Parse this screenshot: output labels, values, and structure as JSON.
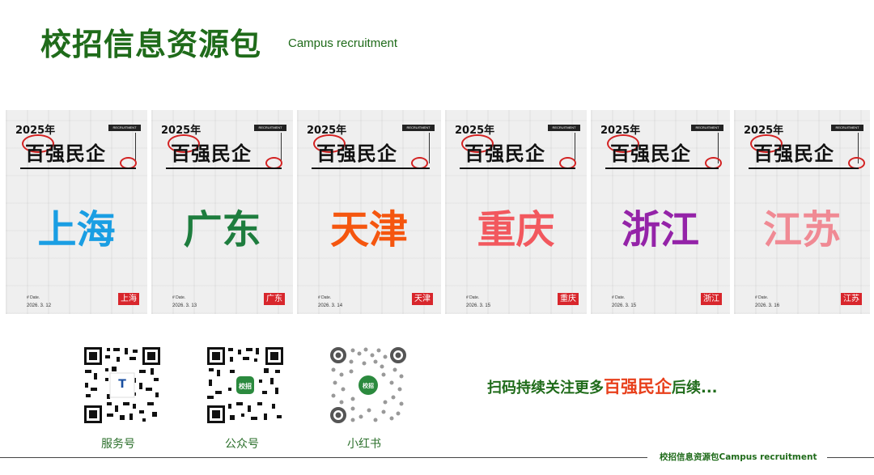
{
  "header": {
    "title": "校招信息资源包",
    "subtitle": "Campus recruitment"
  },
  "cards": [
    {
      "year": "2025年",
      "badge": "RECRUITMENT",
      "headline": "百强民企",
      "city": "上海",
      "city_color": "#1a9ee3",
      "date_label": "# Date.",
      "date": "2026. 3. 12",
      "tag": "上海"
    },
    {
      "year": "2025年",
      "badge": "RECRUITMENT",
      "headline": "百强民企",
      "city": "广东",
      "city_color": "#1e7d3e",
      "date_label": "# Date.",
      "date": "2026. 3. 13",
      "tag": "广东"
    },
    {
      "year": "2025年",
      "badge": "RECRUITMENT",
      "headline": "百强民企",
      "city": "天津",
      "city_color": "#f5560f",
      "date_label": "# Date.",
      "date": "2026. 3. 14",
      "tag": "天津"
    },
    {
      "year": "2025年",
      "badge": "RECRUITMENT",
      "headline": "百强民企",
      "city": "重庆",
      "city_color": "#f2585e",
      "date_label": "# Date.",
      "date": "2026. 3. 15",
      "tag": "重庆"
    },
    {
      "year": "2025年",
      "badge": "RECRUITMENT",
      "headline": "百强民企",
      "city": "浙江",
      "city_color": "#9423a8",
      "date_label": "# Date.",
      "date": "2026. 3. 15",
      "tag": "浙江"
    },
    {
      "year": "2025年",
      "badge": "RECRUITMENT",
      "headline": "百强民企",
      "city": "江苏",
      "city_color": "#f08a94",
      "date_label": "# Date.",
      "date": "2026. 3. 16",
      "tag": "江苏"
    }
  ],
  "qr_codes": [
    {
      "label": "服务号",
      "center_icon": "t-logo-icon"
    },
    {
      "label": "公众号",
      "center_icon": "campus-logo-icon"
    },
    {
      "label": "小红书",
      "center_icon": "campus-logo-icon"
    }
  ],
  "promo": {
    "prefix": "扫码持续关注更多",
    "highlight": "百强民企",
    "suffix": "后续..."
  },
  "footer": {
    "text": "校招信息资源包Campus recruitment"
  }
}
